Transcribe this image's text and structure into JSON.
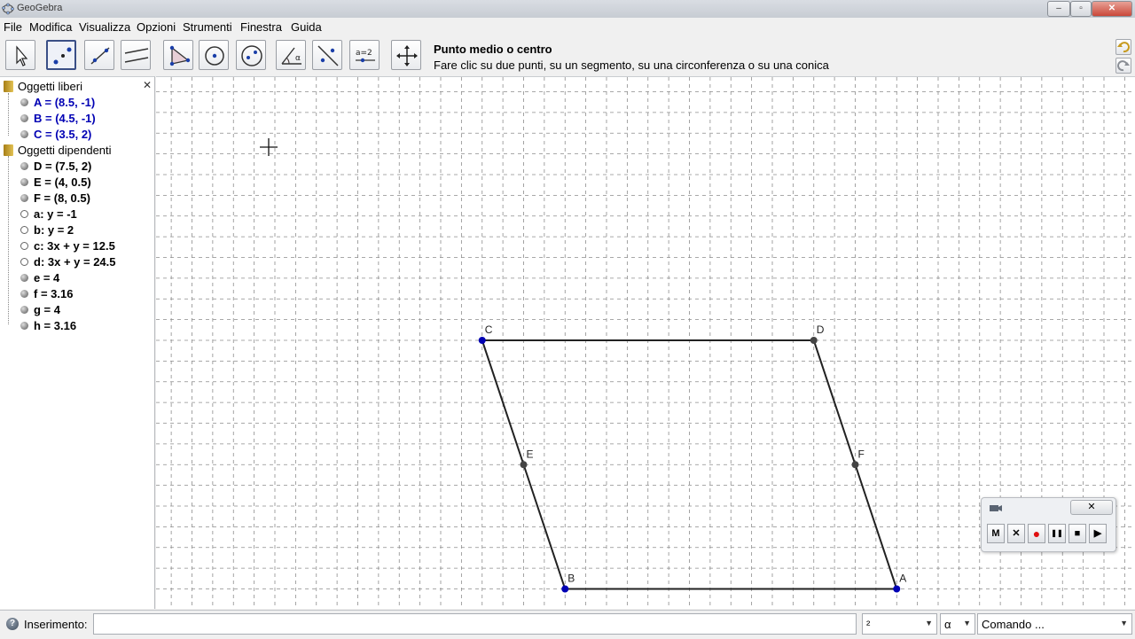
{
  "window": {
    "title": "GeoGebra",
    "buttons": [
      "–",
      "▫",
      "✕"
    ]
  },
  "menu": [
    "File",
    "Modifica",
    "Visualizza",
    "Opzioni",
    "Strumenti",
    "Finestra",
    "Guida"
  ],
  "toolbar": {
    "tools": [
      {
        "name": "move-tool-button",
        "icon": "cursor-arrow-icon"
      },
      {
        "name": "point-tool-button",
        "icon": "points-icon"
      },
      {
        "name": "line-tool-button",
        "icon": "line-icon"
      },
      {
        "name": "parallel-tool-button",
        "icon": "parallel-lines-icon"
      },
      {
        "name": "polygon-tool-button",
        "icon": "triangle-icon"
      },
      {
        "name": "circle-tool-button",
        "icon": "circle-center-icon"
      },
      {
        "name": "conic-tool-button",
        "icon": "ellipse-icon"
      },
      {
        "name": "angle-tool-button",
        "icon": "angle-icon"
      },
      {
        "name": "reflect-tool-button",
        "icon": "reflect-icon"
      },
      {
        "name": "slider-tool-button",
        "icon": "slider-icon"
      },
      {
        "name": "move-view-tool-button",
        "icon": "move-arrows-icon"
      }
    ],
    "selected_index": 1,
    "help_title": "Punto medio o centro",
    "help_text": "Fare clic su due punti, su un segmento, su una circonferenza o su una conica"
  },
  "algebra": {
    "free_folder": "Oggetti liberi",
    "free_objects": [
      "A = (8.5, -1)",
      "B = (4.5, -1)",
      "C = (3.5, 2)"
    ],
    "dependent_folder": "Oggetti dipendenti",
    "dependent_objects": [
      {
        "text": "D = (7.5, 2)",
        "shown": true
      },
      {
        "text": "E = (4, 0.5)",
        "shown": true
      },
      {
        "text": "F = (8, 0.5)",
        "shown": true
      },
      {
        "text": "a: y = -1",
        "shown": false
      },
      {
        "text": "b: y = 2",
        "shown": false
      },
      {
        "text": "c: 3x + y = 12.5",
        "shown": false
      },
      {
        "text": "d: 3x + y = 24.5",
        "shown": false
      },
      {
        "text": "e = 4",
        "shown": true
      },
      {
        "text": "f = 3.16",
        "shown": true
      },
      {
        "text": "g = 4",
        "shown": true
      },
      {
        "text": "h = 3.16",
        "shown": true
      }
    ]
  },
  "graphics": {
    "points": [
      {
        "label": "A",
        "x": 8.5,
        "y": -1,
        "free": true
      },
      {
        "label": "B",
        "x": 4.5,
        "y": -1,
        "free": true
      },
      {
        "label": "C",
        "x": 3.5,
        "y": 2,
        "free": true
      },
      {
        "label": "D",
        "x": 7.5,
        "y": 2,
        "free": false
      },
      {
        "label": "E",
        "x": 4,
        "y": 0.5,
        "free": false
      },
      {
        "label": "F",
        "x": 8,
        "y": 0.5,
        "free": false
      }
    ],
    "segments": [
      [
        "B",
        "A"
      ],
      [
        "C",
        "D"
      ],
      [
        "C",
        "B"
      ],
      [
        "D",
        "A"
      ]
    ]
  },
  "recorder": {
    "close": "✕",
    "buttons": [
      "M",
      "✕",
      "●",
      "❚❚",
      "■",
      "▶"
    ]
  },
  "input_bar": {
    "label": "Inserimento:",
    "value": "",
    "combo1": "²",
    "combo2": "α",
    "combo3": "Comando ..."
  },
  "colors": {
    "free_point": "#0000b4",
    "dependent_point": "#444444",
    "segment": "#222222",
    "grid": "#8c8c8c"
  }
}
